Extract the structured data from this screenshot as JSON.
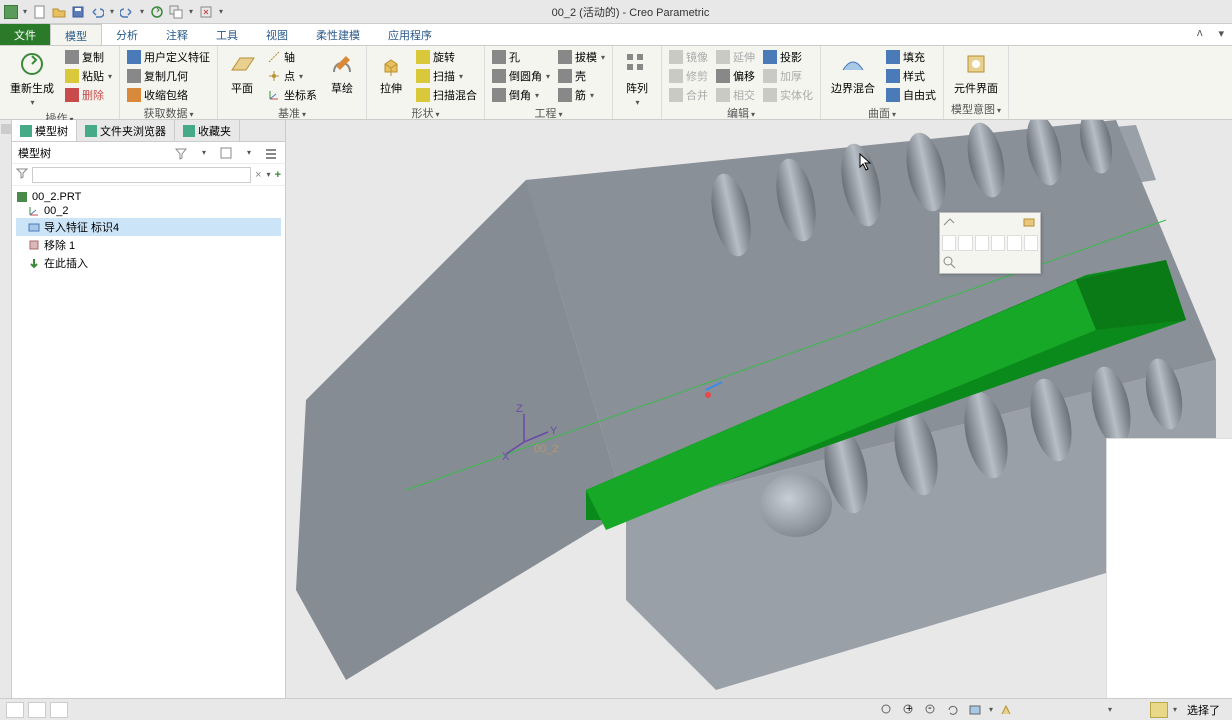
{
  "title": "00_2 (活动的) - Creo Parametric",
  "ribbon_tabs": {
    "file": "文件",
    "model": "模型",
    "analysis": "分析",
    "annotate": "注释",
    "tools": "工具",
    "view": "视图",
    "flex_model": "柔性建模",
    "applications": "应用程序"
  },
  "ribbon": {
    "operate": {
      "label": "操作",
      "regenerate": "重新生成",
      "copy": "复制",
      "paste": "粘贴",
      "delete": "删除"
    },
    "get_data": {
      "label": "获取数据",
      "user_feature": "用户定义特征",
      "copy_geom": "复制几何",
      "shrinkwrap": "收缩包络"
    },
    "datum": {
      "label": "基准",
      "plane": "平面",
      "axis": "轴",
      "point": "点",
      "csys": "坐标系",
      "sketch": "草绘"
    },
    "shape": {
      "label": "形状",
      "extrude": "拉伸",
      "revolve": "旋转",
      "sweep": "扫描",
      "sweep_blend": "扫描混合"
    },
    "engineering": {
      "label": "工程",
      "hole": "孔",
      "round": "倒圆角",
      "chamfer": "倒角",
      "draft": "拔模",
      "shell": "壳",
      "rib": "筋"
    },
    "pattern": {
      "label": "阵列"
    },
    "edit": {
      "label": "编辑",
      "mirror": "镜像",
      "trim": "修剪",
      "merge": "合并",
      "extend": "延伸",
      "offset": "偏移",
      "thicken": "加厚",
      "intersect": "相交",
      "solidify": "实体化"
    },
    "surface": {
      "label": "曲面",
      "boundary_blend": "边界混合",
      "fill": "填充",
      "style": "样式",
      "freestyle": "自由式"
    },
    "model_intent": {
      "label": "模型意图",
      "component_interface": "元件界面"
    }
  },
  "side_panel": {
    "tab_model_tree": "模型树",
    "tab_folder": "文件夹浏览器",
    "tab_favorites": "收藏夹",
    "header": "模型树",
    "search_placeholder": "",
    "tree": {
      "root": "00_2.PRT",
      "n1": "00_2",
      "n2": "导入特征 标识4",
      "n3": "移除 1",
      "n4": "在此插入"
    }
  },
  "model_label": "00_2",
  "axes": {
    "x": "X",
    "y": "Y",
    "z": "Z"
  },
  "status_bar": {
    "message": "选择了"
  }
}
